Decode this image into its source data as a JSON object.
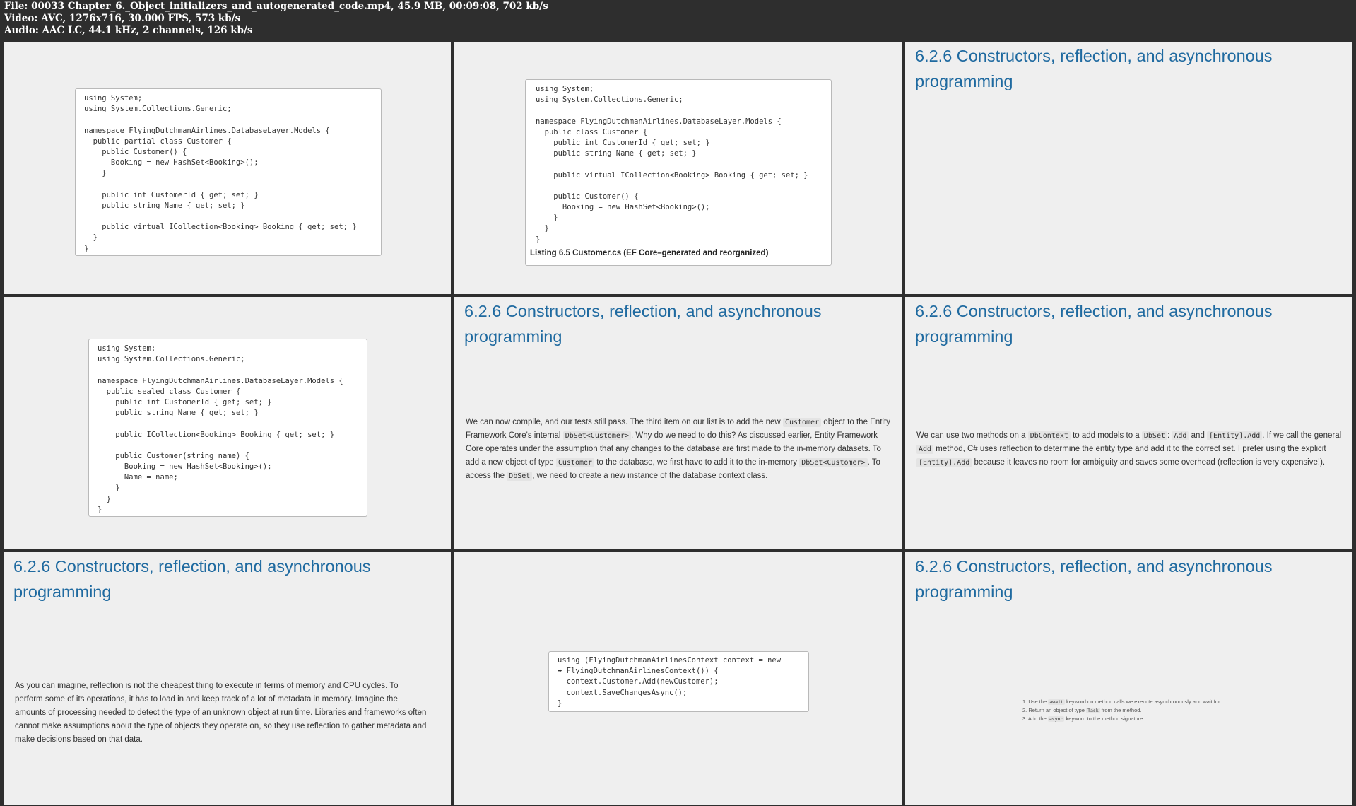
{
  "header": {
    "file_line": "File: 00033 Chapter_6._Object_initializers_and_autogenerated_code.mp4, 45.9 MB, 00:09:08, 702 kb/s",
    "video_line": "Video: AVC, 1276x716, 30.000 FPS, 573 kb/s",
    "audio_line": "Audio: AAC LC, 44.1 kHz, 2 channels, 126 kb/s"
  },
  "slide_title": "6.2.6 Constructors, reflection, and asynchronous programming",
  "panel1": {
    "lines": [
      "using System;",
      "using System.Collections.Generic;",
      "",
      "namespace FlyingDutchmanAirlines.DatabaseLayer.Models {",
      "  public partial class Customer {",
      "    public Customer() {",
      "      Booking = new HashSet<Booking>();",
      "    }",
      "",
      "    public int CustomerId { get; set; }",
      "    public string Name { get; set; }",
      "",
      "    public virtual ICollection<Booking> Booking { get; set; }",
      "  }",
      "}"
    ]
  },
  "panel2": {
    "lines": [
      "using System;",
      "using System.Collections.Generic;",
      "",
      "namespace FlyingDutchmanAirlines.DatabaseLayer.Models {",
      "  public class Customer {",
      "    public int CustomerId { get; set; }",
      "    public string Name { get; set; }",
      "",
      "    public virtual ICollection<Booking> Booking { get; set; }",
      "",
      "    public Customer() {",
      "      Booking = new HashSet<Booking>();",
      "    }",
      "  }",
      "}"
    ],
    "caption": "Listing 6.5 Customer.cs (EF Core–generated and reorganized)"
  },
  "panel4": {
    "lines": [
      "using System;",
      "using System.Collections.Generic;",
      "",
      "namespace FlyingDutchmanAirlines.DatabaseLayer.Models {",
      "  public sealed class Customer {",
      "    public int CustomerId { get; set; }",
      "    public string Name { get; set; }",
      "",
      "    public ICollection<Booking> Booking { get; set; }",
      "",
      "    public Customer(string name) {",
      "      Booking = new HashSet<Booking>();",
      "      Name = name;",
      "    }",
      "  }",
      "}"
    ]
  },
  "panel5": {
    "p1": "We can now compile, and our tests still pass. The third item on our list is to add the new ",
    "c1": "Customer",
    "p2": " object to the Entity Framework Core's internal ",
    "c2": "DbSet<Customer>",
    "p3": ". Why do we need to do this? As discussed earlier, Entity Framework Core operates under the assumption that any changes to the database are first made to the in-memory datasets. To add a new object of type ",
    "c3": "Customer",
    "p4": " to the database, we first have to add it to the in-memory ",
    "c4": "DbSet<Customer>",
    "p5": ". To access the ",
    "c5": "DbSet",
    "p6": ", we need to create a new instance of the database context class."
  },
  "panel6": {
    "p1": "We can use two methods on a ",
    "c1": "DbContext",
    "p2": " to add models to a ",
    "c2": "DbSet",
    "p3": ": ",
    "c3": "Add",
    "p4": " and ",
    "c4": "[Entity].Add",
    "p5": ". If we call the general ",
    "c5": "Add",
    "p6": " method, C# uses reflection to determine the entity type and add it to the correct set. I prefer using the explicit ",
    "c6": "[Entity].Add",
    "p7": " because it leaves no room for ambiguity and saves some overhead (reflection is very expensive!)."
  },
  "panel7": {
    "text": "As you can imagine, reflection is not the cheapest thing to execute in terms of memory and CPU cycles. To perform some of its operations, it has to load in and keep track of a lot of metadata in memory. Imagine the amounts of processing needed to detect the type of an unknown object at run time. Libraries and frameworks often cannot make assumptions about the type of objects they operate on, so they use reflection to gather metadata and make decisions based on that data."
  },
  "panel8": {
    "lines": [
      "using (FlyingDutchmanAirlinesContext context = new",
      "➥ FlyingDutchmanAirlinesContext()) {",
      "  context.Customer.Add(newCustomer);",
      "  context.SaveChangesAsync();",
      "}"
    ]
  },
  "panel9": {
    "item1_a": "1. Use the ",
    "item1_code": "await",
    "item1_b": " keyword on method calls we execute asynchronously and wait for",
    "item2_a": "2. Return an object of type ",
    "item2_code": "Task",
    "item2_b": " from the method.",
    "item3_a": "3. Add the ",
    "item3_code": "async",
    "item3_b": " keyword to the method signature."
  }
}
